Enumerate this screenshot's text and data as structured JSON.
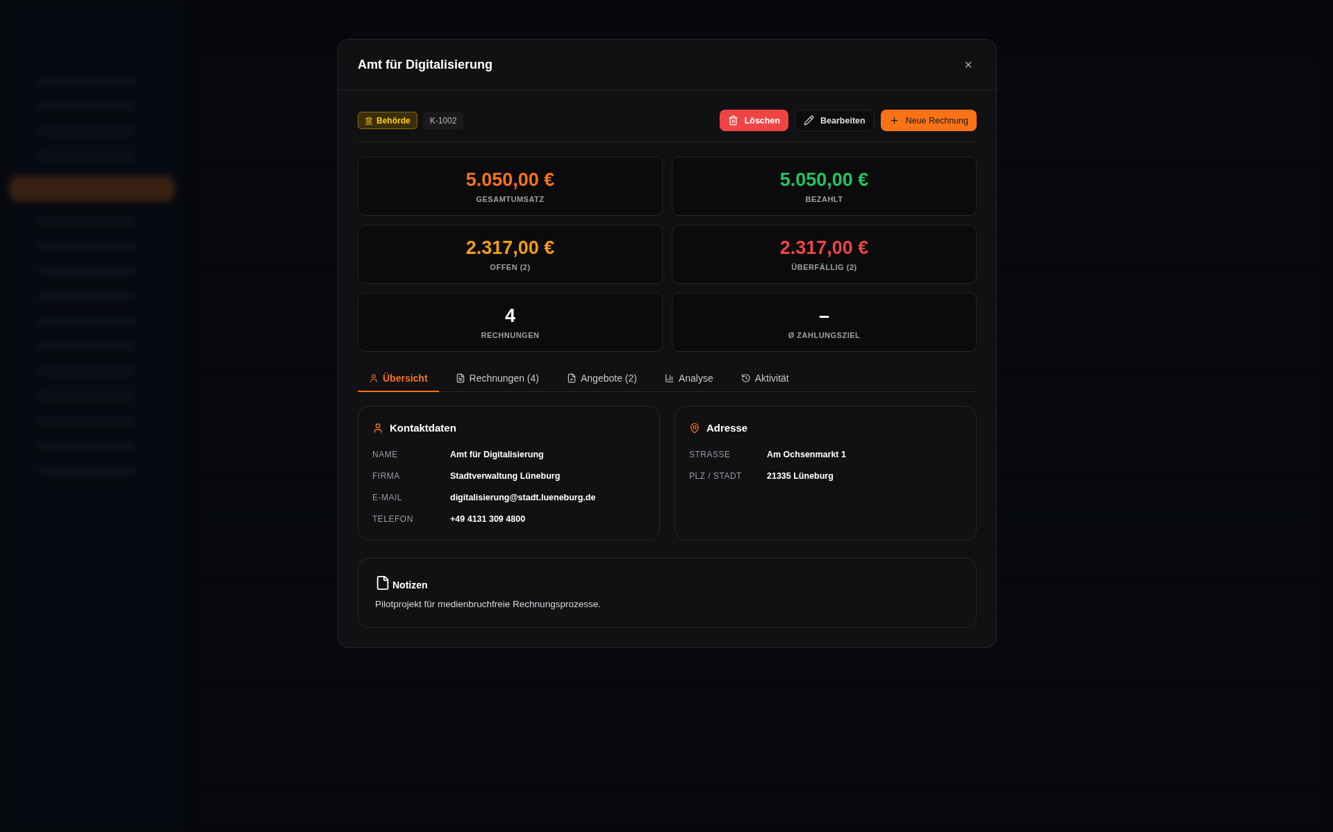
{
  "modal": {
    "title": "Amt für Digitalisierung",
    "close": "×",
    "tags": [
      {
        "kind": "category",
        "label": "Behörde"
      },
      {
        "kind": "id",
        "label": "K-1002"
      }
    ],
    "actions": [
      {
        "kind": "danger",
        "label": "Löschen"
      },
      {
        "kind": "secondary",
        "label": "Bearbeiten"
      },
      {
        "kind": "primary",
        "label": "Neue Rechnung"
      }
    ],
    "stats": [
      {
        "value": "5.050,00 €",
        "label": "GESAMTUMSATZ",
        "color": "#f97316"
      },
      {
        "value": "5.050,00 €",
        "label": "BEZAHLT",
        "color": "#22c55e"
      },
      {
        "value": "2.317,00 €",
        "label": "OFFEN (2)",
        "color": "#f59e0b"
      },
      {
        "value": "2.317,00 €",
        "label": "ÜBERFÄLLIG (2)",
        "color": "#ef4444"
      },
      {
        "value": "4",
        "label": "RECHNUNGEN",
        "color": "#ffffff"
      },
      {
        "value": "–",
        "label": "Ø ZAHLUNGSZIEL",
        "color": "#ffffff"
      }
    ],
    "tabs": [
      {
        "label": "Übersicht",
        "selected": true
      },
      {
        "label": "Rechnungen (4)",
        "selected": false
      },
      {
        "label": "Angebote (2)",
        "selected": false
      },
      {
        "label": "Analyse",
        "selected": false
      },
      {
        "label": "Aktivität",
        "selected": false
      }
    ],
    "contact": {
      "title": "Kontaktdaten",
      "fields": [
        {
          "label": "NAME",
          "value": "Amt für Digitalisierung"
        },
        {
          "label": "FIRMA",
          "value": "Stadtverwaltung Lüneburg"
        },
        {
          "label": "E-MAIL",
          "value": "digitalisierung@stadt.lueneburg.de"
        },
        {
          "label": "TELEFON",
          "value": "+49 4131 309 4800"
        }
      ]
    },
    "address": {
      "title": "Adresse",
      "fields": [
        {
          "label": "STRASSE",
          "value": "Am Ochsenmarkt 1"
        },
        {
          "label": "PLZ / STADT",
          "value": "21335 Lüneburg"
        }
      ]
    },
    "notes": {
      "title": "Notizen",
      "text": "Pilotprojekt für medienbruchfreie Rechnungsprozesse."
    }
  }
}
